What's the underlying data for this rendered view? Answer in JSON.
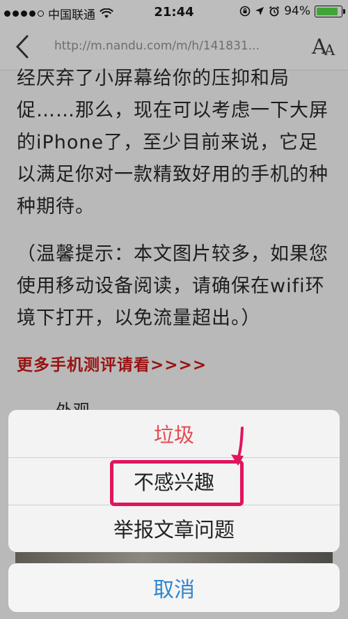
{
  "status_bar": {
    "carrier": "中国联通",
    "time": "21:44",
    "battery_percent": "94%",
    "battery_level": 0.94,
    "icons": [
      "signal-icon",
      "wifi-icon",
      "rotation-lock-icon",
      "location-icon",
      "alarm-icon",
      "battery-icon"
    ]
  },
  "nav": {
    "url": "http://m.nandu.com/m/h/141831...",
    "back_icon": "chevron-left-icon",
    "font_icon": "font-size-icon"
  },
  "article": {
    "paragraph1": "经厌弃了小屏幕给你的压抑和局促……那么，现在可以考虑一下大屏的iPhone了，至少目前来说，它足以满足你对一款精致好用的手机的种种期待。",
    "paragraph2": "（温馨提示：本文图片较多，如果您使用移动设备阅读，请确保在wifi环境下打开，以免流量超出。）",
    "link": "更多手机测评请看>>>>",
    "subheading": "外观"
  },
  "action_sheet": {
    "trash_label": "垃圾",
    "not_interested_label": "不感兴趣",
    "report_label": "举报文章问题",
    "cancel_label": "取消"
  },
  "colors": {
    "destructive": "#e64a52",
    "cancel": "#2f86cf",
    "highlight": "#e0145e",
    "link": "#9a1212"
  }
}
